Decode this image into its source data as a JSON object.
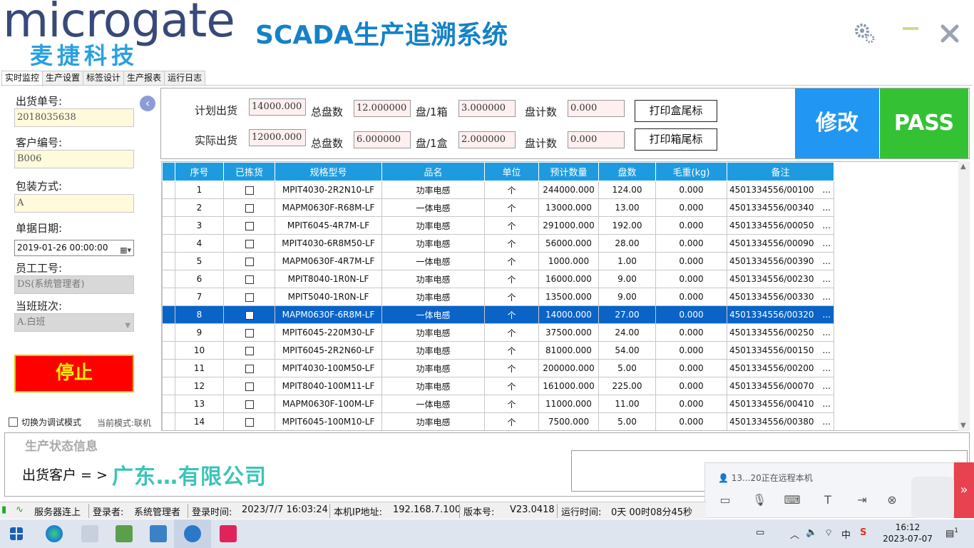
{
  "header": {
    "logo_text": "microgate",
    "logo_cn": "麦捷科技",
    "title": "SCADA生产追溯系统"
  },
  "tabs": [
    "实时监控",
    "生产设置",
    "标签设计",
    "生产报表",
    "运行日志"
  ],
  "left": {
    "order_no_label": "出货单号:",
    "order_no": "2018035638",
    "customer_no_label": "客户编号:",
    "customer_no": "B006",
    "pack_label": "包装方式:",
    "pack": "A",
    "date_label": "单据日期:",
    "date": "2019-01-26 00:00:00",
    "employee_label": "员工工号:",
    "employee": "DS(系统管理者)",
    "shift_label": "当班班次:",
    "shift": "A.白班",
    "stop_label": "停止",
    "debug_label": "切换为调试模式",
    "mode_text": "当前模式:联机"
  },
  "summary": {
    "plan_label": "计划出货",
    "plan_value": "14000.000",
    "total_reels_label": "总盘数",
    "plan_total_reels": "12.000000",
    "reel_per_case_label": "盘/1箱",
    "reel_per_case": "3.000000",
    "reel_count_label": "盘计数",
    "plan_reel_count": "0.000",
    "print_box_label": "打印盒尾标",
    "actual_label": "实际出货",
    "actual_value": "12000.000",
    "actual_total_reels": "6.000000",
    "reel_per_box_label": "盘/1盒",
    "reel_per_box": "2.000000",
    "actual_reel_count": "0.000",
    "print_case_label": "打印箱尾标",
    "modify_label": "修改",
    "pass_label": "PASS"
  },
  "grid": {
    "columns": [
      "序号",
      "已拣货",
      "规格型号",
      "品名",
      "单位",
      "预计数量",
      "盘数",
      "毛重(kg)",
      "备注"
    ],
    "rows": [
      {
        "no": "1",
        "model": "MPIT4030-2R2N10-LF",
        "name": "功率电感",
        "unit": "个",
        "qty": "244000.000",
        "reels": "124.00",
        "weight": "0.000",
        "note": "4501334556/00100"
      },
      {
        "no": "2",
        "model": "MAPM0630F-R68M-LF",
        "name": "一体电感",
        "unit": "个",
        "qty": "13000.000",
        "reels": "13.00",
        "weight": "0.000",
        "note": "4501334556/00340"
      },
      {
        "no": "3",
        "model": "MPIT6045-4R7M-LF",
        "name": "功率电感",
        "unit": "个",
        "qty": "291000.000",
        "reels": "192.00",
        "weight": "0.000",
        "note": "4501334556/00050"
      },
      {
        "no": "4",
        "model": "MPIT4030-6R8M50-LF",
        "name": "功率电感",
        "unit": "个",
        "qty": "56000.000",
        "reels": "28.00",
        "weight": "0.000",
        "note": "4501334556/00090"
      },
      {
        "no": "5",
        "model": "MAPM0630F-4R7M-LF",
        "name": "一体电感",
        "unit": "个",
        "qty": "1000.000",
        "reels": "1.00",
        "weight": "0.000",
        "note": "4501334556/00390"
      },
      {
        "no": "6",
        "model": "MPIT8040-1R0N-LF",
        "name": "功率电感",
        "unit": "个",
        "qty": "16000.000",
        "reels": "9.00",
        "weight": "0.000",
        "note": "4501334556/00230"
      },
      {
        "no": "7",
        "model": "MPIT5040-1R0N-LF",
        "name": "功率电感",
        "unit": "个",
        "qty": "13500.000",
        "reels": "9.00",
        "weight": "0.000",
        "note": "4501334556/00330"
      },
      {
        "no": "8",
        "model": "MAPM0630F-6R8M-LF",
        "name": "一体电感",
        "unit": "个",
        "qty": "14000.000",
        "reels": "27.00",
        "weight": "0.000",
        "note": "4501334556/00320"
      },
      {
        "no": "9",
        "model": "MPIT6045-220M30-LF",
        "name": "功率电感",
        "unit": "个",
        "qty": "37500.000",
        "reels": "24.00",
        "weight": "0.000",
        "note": "4501334556/00250"
      },
      {
        "no": "10",
        "model": "MPIT6045-2R2N60-LF",
        "name": "功率电感",
        "unit": "个",
        "qty": "81000.000",
        "reels": "54.00",
        "weight": "0.000",
        "note": "4501334556/00150"
      },
      {
        "no": "11",
        "model": "MPIT4030-100M50-LF",
        "name": "功率电感",
        "unit": "个",
        "qty": "200000.000",
        "reels": "5.00",
        "weight": "0.000",
        "note": "4501334556/00200"
      },
      {
        "no": "12",
        "model": "MPIT8040-100M11-LF",
        "name": "功率电感",
        "unit": "个",
        "qty": "161000.000",
        "reels": "225.00",
        "weight": "0.000",
        "note": "4501334556/00070"
      },
      {
        "no": "13",
        "model": "MAPM0630F-100M-LF",
        "name": "一体电感",
        "unit": "个",
        "qty": "11000.000",
        "reels": "11.00",
        "weight": "0.000",
        "note": "4501334556/00410"
      },
      {
        "no": "14",
        "model": "MPIT6045-100M10-LF",
        "name": "功率电感",
        "unit": "个",
        "qty": "7500.000",
        "reels": "5.00",
        "weight": "0.000",
        "note": "4501334556/00380"
      }
    ],
    "note_more": "...",
    "selected_row": "8"
  },
  "status_panel": {
    "title": "生产状态信息",
    "customer_label": "出货客户 = >",
    "customer_value": "广东…有限公司"
  },
  "remote": {
    "text": "13...20正在远程本机"
  },
  "statusbar": {
    "server": "服务器连上",
    "login_user_label": "登录者:",
    "login_user": "系统管理者",
    "login_time_label": "登录时间:",
    "login_time": "2023/7/7 16:03:24",
    "ip_label": "本机IP地址:",
    "ip": "192.168.7.100",
    "version_label": "版本号:",
    "version": "V23.0418",
    "runtime_label": "运行时间:",
    "runtime": "0天 00时08分45秒"
  },
  "taskbar": {
    "time": "16:12",
    "date": "2023-07-07",
    "ime": "中",
    "notif_count": "1"
  },
  "colors": {
    "title_blue": "#1482c8",
    "grid_header": "#1e9be0",
    "selected_row": "#0a64c8",
    "stop_red": "#ff0000",
    "modify_blue": "#2196f3",
    "pass_green": "#34c234"
  }
}
